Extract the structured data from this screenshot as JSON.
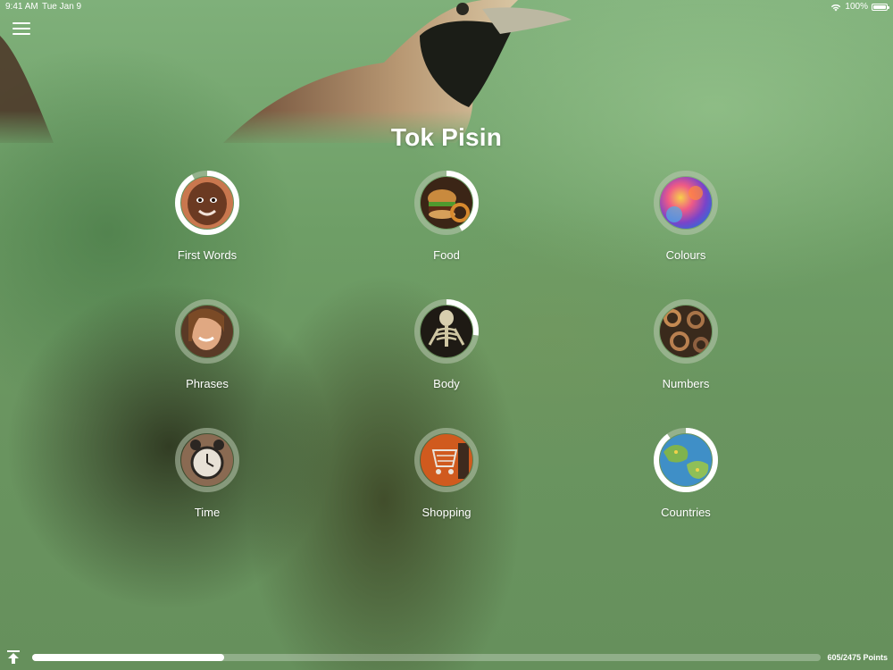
{
  "status_bar": {
    "time": "9:41 AM",
    "date": "Tue Jan 9",
    "battery": "100%",
    "icons": [
      "wifi-icon",
      "battery-icon"
    ]
  },
  "header": {
    "menu_icon": "hamburger-icon",
    "title": "Tok Pisin"
  },
  "topics": [
    {
      "label": "First Words",
      "progress": 0.92,
      "image": "child-face"
    },
    {
      "label": "Food",
      "progress": 0.42,
      "image": "burger"
    },
    {
      "label": "Colours",
      "progress": 0.0,
      "image": "color-splash"
    },
    {
      "label": "Phrases",
      "progress": 0.0,
      "image": "smiling-woman"
    },
    {
      "label": "Body",
      "progress": 0.27,
      "image": "skeleton"
    },
    {
      "label": "Numbers",
      "progress": 0.0,
      "image": "metal-numbers"
    },
    {
      "label": "Time",
      "progress": 0.0,
      "image": "alarm-clock"
    },
    {
      "label": "Shopping",
      "progress": 0.0,
      "image": "shopping-cart"
    },
    {
      "label": "Countries",
      "progress": 0.9,
      "image": "world-map"
    }
  ],
  "footer": {
    "upload_icon": "upload-icon",
    "points_text": "605/2475 Points",
    "progress": 0.244
  },
  "colors": {
    "ring_track": "#b9c9b1",
    "ring_fill": "#ffffff",
    "background": "#6e9e66"
  }
}
